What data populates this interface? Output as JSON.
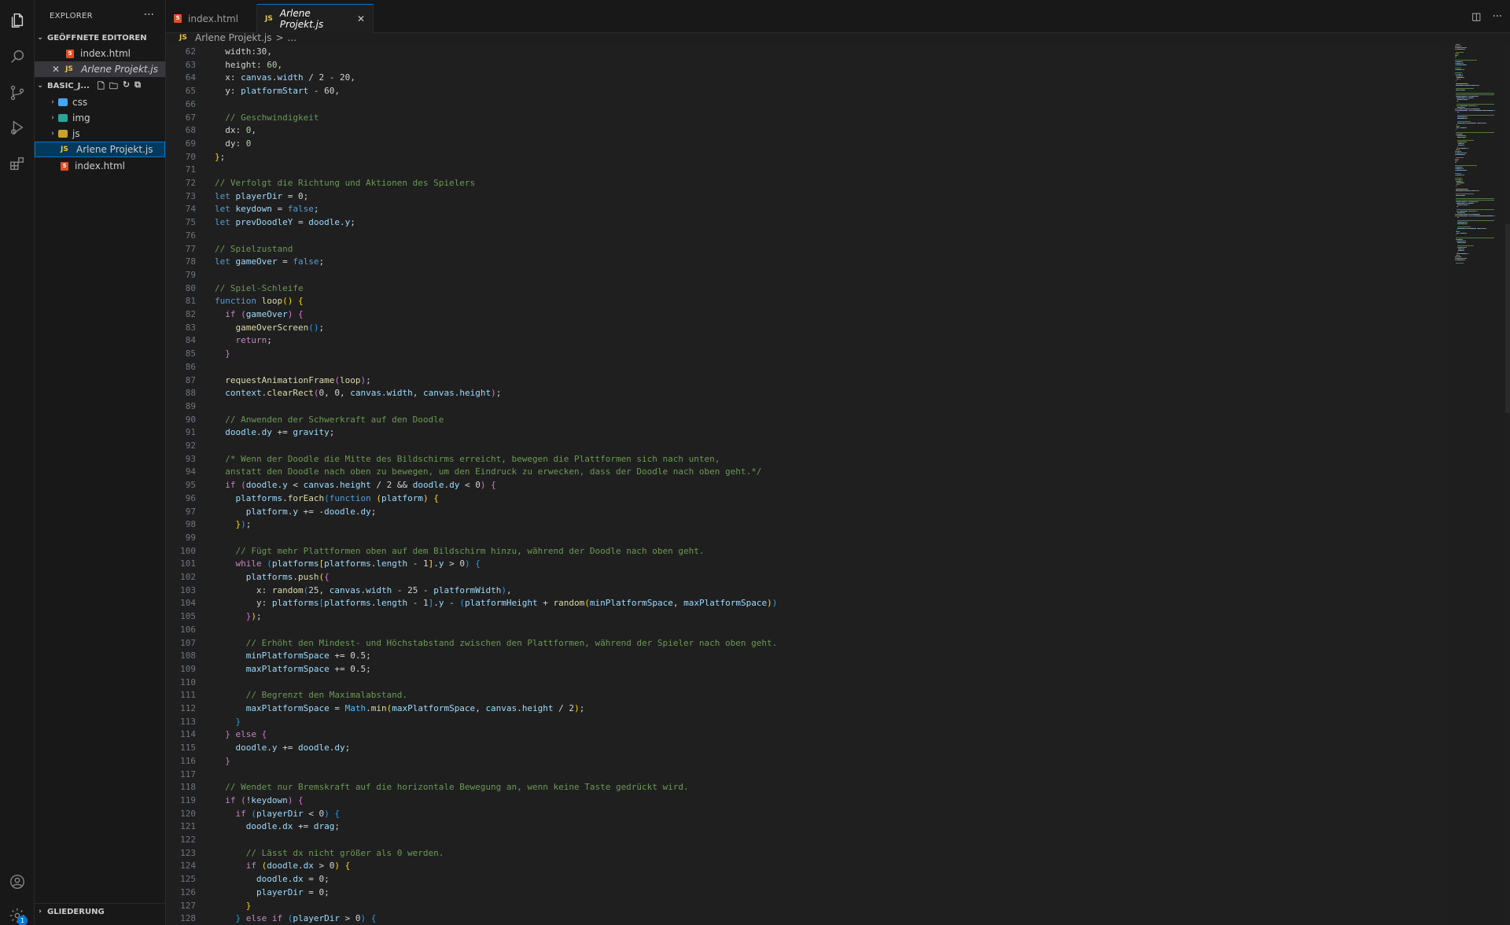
{
  "sidebar": {
    "title": "EXPLORER",
    "more": "···",
    "open_editors_label": "GEÖFFNETE EDITOREN",
    "open_editors": [
      {
        "name": "index.html",
        "type": "html"
      },
      {
        "name": "Arlene Projekt.js",
        "type": "js",
        "active": true
      }
    ],
    "project_label": "BASIC_J...",
    "files": [
      {
        "name": "css",
        "type": "folder"
      },
      {
        "name": "img",
        "type": "folder"
      },
      {
        "name": "js",
        "type": "folder"
      },
      {
        "name": "Arlene Projekt.js",
        "type": "js"
      },
      {
        "name": "index.html",
        "type": "html"
      }
    ],
    "outline_label": "GLIEDERUNG"
  },
  "tabs": [
    {
      "label": "index.html",
      "icon": "html-icon"
    },
    {
      "label": "Arlene Projekt.js",
      "icon": "js-icon",
      "active": true
    }
  ],
  "breadcrumb": {
    "file": "Arlene Projekt.js",
    "sep": ">",
    "rest": "..."
  },
  "editor": {
    "first_line": 62,
    "lines": [
      [
        [
          "  ",
          ""
        ],
        [
          "width",
          ""
        ],
        [
          ":30,",
          ""
        ]
      ],
      [
        [
          "  height: ",
          ""
        ],
        [
          "60",
          "num"
        ],
        [
          ",",
          ""
        ]
      ],
      [
        [
          "  x: ",
          ""
        ],
        [
          "canvas",
          "var"
        ],
        [
          ".",
          ""
        ],
        [
          "width",
          "prop"
        ],
        [
          " / 2 - 20,",
          ""
        ]
      ],
      [
        [
          "  y: ",
          ""
        ],
        [
          "platformStart",
          "var"
        ],
        [
          " - 60,",
          ""
        ]
      ],
      [
        [
          "",
          ""
        ]
      ],
      [
        [
          "  ",
          ""
        ],
        [
          "// Geschwindigkeit",
          "com"
        ]
      ],
      [
        [
          "  dx: ",
          ""
        ],
        [
          "0",
          "num"
        ],
        [
          ",",
          ""
        ]
      ],
      [
        [
          "  dy: ",
          ""
        ],
        [
          "0",
          "num"
        ]
      ],
      [
        [
          "}",
          "b1"
        ],
        [
          ";",
          ""
        ]
      ],
      [
        [
          "",
          ""
        ]
      ],
      [
        [
          "// Verfolgt die Richtung und Aktionen des Spielers",
          "com"
        ]
      ],
      [
        [
          "let ",
          "kw"
        ],
        [
          "playerDir",
          "var"
        ],
        [
          " = 0;",
          ""
        ]
      ],
      [
        [
          "let ",
          "kw"
        ],
        [
          "keydown",
          "var"
        ],
        [
          " = ",
          ""
        ],
        [
          "false",
          "kw"
        ],
        [
          ";",
          ""
        ]
      ],
      [
        [
          "let ",
          "kw"
        ],
        [
          "prevDoodleY",
          "var"
        ],
        [
          " = ",
          ""
        ],
        [
          "doodle",
          "var"
        ],
        [
          ".",
          ""
        ],
        [
          "y",
          "prop"
        ],
        [
          ";",
          ""
        ]
      ],
      [
        [
          "",
          ""
        ]
      ],
      [
        [
          "// Spielzustand",
          "com"
        ]
      ],
      [
        [
          "let ",
          "kw"
        ],
        [
          "gameOver",
          "var"
        ],
        [
          " = ",
          ""
        ],
        [
          "false",
          "kw"
        ],
        [
          ";",
          ""
        ]
      ],
      [
        [
          "",
          ""
        ]
      ],
      [
        [
          "// Spiel-Schleife",
          "com"
        ]
      ],
      [
        [
          "function ",
          "kw"
        ],
        [
          "loop",
          "fn"
        ],
        [
          "()",
          "b1"
        ],
        [
          " ",
          ""
        ],
        [
          "{",
          "b1"
        ]
      ],
      [
        [
          "  ",
          ""
        ],
        [
          "if ",
          "ctl"
        ],
        [
          "(",
          "b2"
        ],
        [
          "gameOver",
          "var"
        ],
        [
          ")",
          "b2"
        ],
        [
          " ",
          ""
        ],
        [
          "{",
          "b2"
        ]
      ],
      [
        [
          "    ",
          ""
        ],
        [
          "gameOverScreen",
          "fn"
        ],
        [
          "()",
          "b3"
        ],
        [
          ";",
          ""
        ]
      ],
      [
        [
          "    ",
          ""
        ],
        [
          "return",
          "ctl"
        ],
        [
          ";",
          ""
        ]
      ],
      [
        [
          "  ",
          ""
        ],
        [
          "}",
          "b2"
        ]
      ],
      [
        [
          "",
          ""
        ]
      ],
      [
        [
          "  ",
          ""
        ],
        [
          "requestAnimationFrame",
          "fn"
        ],
        [
          "(",
          "b2"
        ],
        [
          "loop",
          "fn"
        ],
        [
          ")",
          "b2"
        ],
        [
          ";",
          ""
        ]
      ],
      [
        [
          "  ",
          ""
        ],
        [
          "context",
          "var"
        ],
        [
          ".",
          ""
        ],
        [
          "clearRect",
          "fn"
        ],
        [
          "(",
          "b2"
        ],
        [
          "0, 0, ",
          ""
        ],
        [
          "canvas",
          "var"
        ],
        [
          ".",
          ""
        ],
        [
          "width",
          "prop"
        ],
        [
          ", ",
          ""
        ],
        [
          "canvas",
          "var"
        ],
        [
          ".",
          ""
        ],
        [
          "height",
          "prop"
        ],
        [
          ")",
          "b2"
        ],
        [
          ";",
          ""
        ]
      ],
      [
        [
          "",
          ""
        ]
      ],
      [
        [
          "  ",
          ""
        ],
        [
          "// Anwenden der Schwerkraft auf den Doodle",
          "com"
        ]
      ],
      [
        [
          "  ",
          ""
        ],
        [
          "doodle",
          "var"
        ],
        [
          ".",
          ""
        ],
        [
          "dy",
          "prop"
        ],
        [
          " += ",
          ""
        ],
        [
          "gravity",
          "var"
        ],
        [
          ";",
          ""
        ]
      ],
      [
        [
          "",
          ""
        ]
      ],
      [
        [
          "  ",
          ""
        ],
        [
          "/* Wenn der Doodle die Mitte des Bildschirms erreicht, bewegen die Plattformen sich nach unten,",
          "com"
        ]
      ],
      [
        [
          "  ",
          ""
        ],
        [
          "anstatt den Doodle nach oben zu bewegen, um den Eindruck zu erwecken, dass der Doodle nach oben geht.*/",
          "com"
        ]
      ],
      [
        [
          "  ",
          ""
        ],
        [
          "if ",
          "ctl"
        ],
        [
          "(",
          "b2"
        ],
        [
          "doodle",
          "var"
        ],
        [
          ".",
          ""
        ],
        [
          "y",
          "prop"
        ],
        [
          " < ",
          ""
        ],
        [
          "canvas",
          "var"
        ],
        [
          ".",
          ""
        ],
        [
          "height",
          "prop"
        ],
        [
          " / 2 && ",
          ""
        ],
        [
          "doodle",
          "var"
        ],
        [
          ".",
          ""
        ],
        [
          "dy",
          "prop"
        ],
        [
          " < 0",
          ""
        ],
        [
          ")",
          "b2"
        ],
        [
          " ",
          ""
        ],
        [
          "{",
          "b2"
        ]
      ],
      [
        [
          "    ",
          ""
        ],
        [
          "platforms",
          "var"
        ],
        [
          ".",
          ""
        ],
        [
          "forEach",
          "fn"
        ],
        [
          "(",
          "b3"
        ],
        [
          "function ",
          "kw"
        ],
        [
          "(",
          "b1"
        ],
        [
          "platform",
          "var"
        ],
        [
          ")",
          "b1"
        ],
        [
          " ",
          ""
        ],
        [
          "{",
          "b1"
        ]
      ],
      [
        [
          "      ",
          ""
        ],
        [
          "platform",
          "var"
        ],
        [
          ".",
          ""
        ],
        [
          "y",
          "prop"
        ],
        [
          " += -",
          ""
        ],
        [
          "doodle",
          "var"
        ],
        [
          ".",
          ""
        ],
        [
          "dy",
          "prop"
        ],
        [
          ";",
          ""
        ]
      ],
      [
        [
          "    ",
          ""
        ],
        [
          "}",
          "b1"
        ],
        [
          ")",
          "b3"
        ],
        [
          ";",
          ""
        ]
      ],
      [
        [
          "",
          ""
        ]
      ],
      [
        [
          "    ",
          ""
        ],
        [
          "// Fügt mehr Plattformen oben auf dem Bildschirm hinzu, während der Doodle nach oben geht.",
          "com"
        ]
      ],
      [
        [
          "    ",
          ""
        ],
        [
          "while ",
          "ctl"
        ],
        [
          "(",
          "b3"
        ],
        [
          "platforms",
          "var"
        ],
        [
          "[",
          "b1"
        ],
        [
          "platforms",
          "var"
        ],
        [
          ".",
          ""
        ],
        [
          "length",
          "prop"
        ],
        [
          " - 1",
          ""
        ],
        [
          "]",
          "b1"
        ],
        [
          ".",
          ""
        ],
        [
          "y",
          "prop"
        ],
        [
          " > 0",
          ""
        ],
        [
          ")",
          "b3"
        ],
        [
          " ",
          ""
        ],
        [
          "{",
          "b3"
        ]
      ],
      [
        [
          "      ",
          ""
        ],
        [
          "platforms",
          "var"
        ],
        [
          ".",
          ""
        ],
        [
          "push",
          "fn"
        ],
        [
          "(",
          "b1"
        ],
        [
          "{",
          "b2"
        ]
      ],
      [
        [
          "        x: ",
          ""
        ],
        [
          "random",
          "fn"
        ],
        [
          "(",
          "b3"
        ],
        [
          "25, ",
          ""
        ],
        [
          "canvas",
          "var"
        ],
        [
          ".",
          ""
        ],
        [
          "width",
          "prop"
        ],
        [
          " - 25 - ",
          ""
        ],
        [
          "platformWidth",
          "var"
        ],
        [
          ")",
          "b3"
        ],
        [
          ",",
          ""
        ]
      ],
      [
        [
          "        y: ",
          ""
        ],
        [
          "platforms",
          "var"
        ],
        [
          "[",
          "b3"
        ],
        [
          "platforms",
          "var"
        ],
        [
          ".",
          ""
        ],
        [
          "length",
          "prop"
        ],
        [
          " - 1",
          ""
        ],
        [
          "]",
          "b3"
        ],
        [
          ".",
          ""
        ],
        [
          "y",
          "prop"
        ],
        [
          " - ",
          ""
        ],
        [
          "(",
          "b3"
        ],
        [
          "platformHeight",
          "var"
        ],
        [
          " + ",
          ""
        ],
        [
          "random",
          "fn"
        ],
        [
          "(",
          "b1"
        ],
        [
          "minPlatformSpace",
          "var"
        ],
        [
          ", ",
          ""
        ],
        [
          "maxPlatformSpace",
          "var"
        ],
        [
          ")",
          "b1"
        ],
        [
          ")",
          "b3"
        ]
      ],
      [
        [
          "      ",
          ""
        ],
        [
          "}",
          "b2"
        ],
        [
          ")",
          "b1"
        ],
        [
          ";",
          ""
        ]
      ],
      [
        [
          "",
          ""
        ]
      ],
      [
        [
          "      ",
          ""
        ],
        [
          "// Erhöht den Mindest- und Höchstabstand zwischen den Plattformen, während der Spieler nach oben geht.",
          "com"
        ]
      ],
      [
        [
          "      ",
          ""
        ],
        [
          "minPlatformSpace",
          "var"
        ],
        [
          " += 0.5;",
          ""
        ]
      ],
      [
        [
          "      ",
          ""
        ],
        [
          "maxPlatformSpace",
          "var"
        ],
        [
          " += 0.5;",
          ""
        ]
      ],
      [
        [
          "",
          ""
        ]
      ],
      [
        [
          "      ",
          ""
        ],
        [
          "// Begrenzt den Maximalabstand.",
          "com"
        ]
      ],
      [
        [
          "      ",
          ""
        ],
        [
          "maxPlatformSpace",
          "var"
        ],
        [
          " = ",
          ""
        ],
        [
          "Math",
          "const"
        ],
        [
          ".",
          ""
        ],
        [
          "min",
          "fn"
        ],
        [
          "(",
          "b1"
        ],
        [
          "maxPlatformSpace",
          "var"
        ],
        [
          ", ",
          ""
        ],
        [
          "canvas",
          "var"
        ],
        [
          ".",
          ""
        ],
        [
          "height",
          "prop"
        ],
        [
          " / 2",
          ""
        ],
        [
          ")",
          "b1"
        ],
        [
          ";",
          ""
        ]
      ],
      [
        [
          "    ",
          ""
        ],
        [
          "}",
          "b3"
        ]
      ],
      [
        [
          "  ",
          ""
        ],
        [
          "}",
          "b2"
        ],
        [
          " else ",
          "ctl"
        ],
        [
          "{",
          "b2"
        ]
      ],
      [
        [
          "    ",
          ""
        ],
        [
          "doodle",
          "var"
        ],
        [
          ".",
          ""
        ],
        [
          "y",
          "prop"
        ],
        [
          " += ",
          ""
        ],
        [
          "doodle",
          "var"
        ],
        [
          ".",
          ""
        ],
        [
          "dy",
          "prop"
        ],
        [
          ";",
          ""
        ]
      ],
      [
        [
          "  ",
          ""
        ],
        [
          "}",
          "b2"
        ]
      ],
      [
        [
          "",
          ""
        ]
      ],
      [
        [
          "  ",
          ""
        ],
        [
          "// Wendet nur Bremskraft auf die horizontale Bewegung an, wenn keine Taste gedrückt wird.",
          "com"
        ]
      ],
      [
        [
          "  ",
          ""
        ],
        [
          "if ",
          "ctl"
        ],
        [
          "(",
          "b2"
        ],
        [
          "!",
          ""
        ],
        [
          "keydown",
          "var"
        ],
        [
          ")",
          "b2"
        ],
        [
          " ",
          ""
        ],
        [
          "{",
          "b2"
        ]
      ],
      [
        [
          "    ",
          ""
        ],
        [
          "if ",
          "ctl"
        ],
        [
          "(",
          "b3"
        ],
        [
          "playerDir",
          "var"
        ],
        [
          " < 0",
          ""
        ],
        [
          ")",
          "b3"
        ],
        [
          " ",
          ""
        ],
        [
          "{",
          "b3"
        ]
      ],
      [
        [
          "      ",
          ""
        ],
        [
          "doodle",
          "var"
        ],
        [
          ".",
          ""
        ],
        [
          "dx",
          "prop"
        ],
        [
          " += ",
          ""
        ],
        [
          "drag",
          "var"
        ],
        [
          ";",
          ""
        ]
      ],
      [
        [
          "",
          ""
        ]
      ],
      [
        [
          "      ",
          ""
        ],
        [
          "// Lässt dx nicht größer als 0 werden.",
          "com"
        ]
      ],
      [
        [
          "      ",
          ""
        ],
        [
          "if ",
          "ctl"
        ],
        [
          "(",
          "b1"
        ],
        [
          "doodle",
          "var"
        ],
        [
          ".",
          ""
        ],
        [
          "dx",
          "prop"
        ],
        [
          " > 0",
          ""
        ],
        [
          ")",
          "b1"
        ],
        [
          " ",
          ""
        ],
        [
          "{",
          "b1"
        ]
      ],
      [
        [
          "        ",
          ""
        ],
        [
          "doodle",
          "var"
        ],
        [
          ".",
          ""
        ],
        [
          "dx",
          "prop"
        ],
        [
          " = 0;",
          ""
        ]
      ],
      [
        [
          "        ",
          ""
        ],
        [
          "playerDir",
          "var"
        ],
        [
          " = 0;",
          ""
        ]
      ],
      [
        [
          "      ",
          ""
        ],
        [
          "}",
          "b1"
        ]
      ],
      [
        [
          "    ",
          ""
        ],
        [
          "}",
          "b3"
        ],
        [
          " else if ",
          "ctl"
        ],
        [
          "(",
          "b3"
        ],
        [
          "playerDir",
          "var"
        ],
        [
          " > 0",
          ""
        ],
        [
          ")",
          "b3"
        ],
        [
          " ",
          ""
        ],
        [
          "{",
          "b3"
        ]
      ]
    ]
  }
}
